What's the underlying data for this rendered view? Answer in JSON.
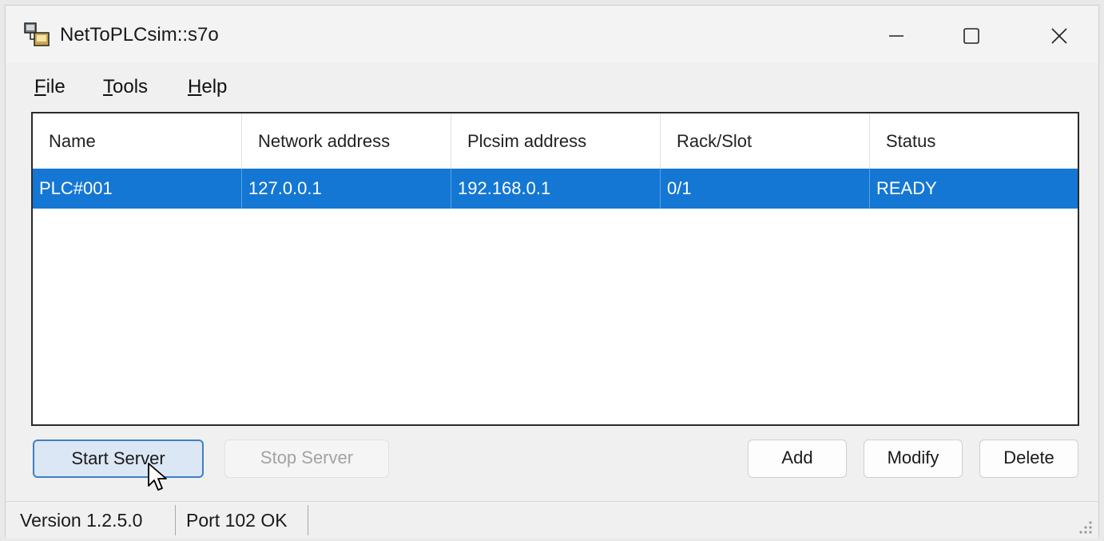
{
  "window": {
    "title": "NetToPLCsim::s7o",
    "controls": {
      "minimize_icon": "minimize-icon",
      "maximize_icon": "maximize-icon",
      "close_icon": "close-icon"
    }
  },
  "menu": {
    "file": {
      "accel": "F",
      "rest": "ile"
    },
    "tools": {
      "accel": "T",
      "rest": "ools"
    },
    "help": {
      "accel": "H",
      "rest": "elp"
    }
  },
  "table": {
    "columns": [
      "Name",
      "Network address",
      "Plcsim address",
      "Rack/Slot",
      "Status"
    ],
    "rows": [
      {
        "name": "PLC#001",
        "network_address": "127.0.0.1",
        "plcsim_address": "192.168.0.1",
        "rack_slot": "0/1",
        "status": "READY",
        "selected": true
      }
    ]
  },
  "buttons": {
    "start_server": "Start Server",
    "stop_server": "Stop Server",
    "add": "Add",
    "modify": "Modify",
    "delete": "Delete"
  },
  "statusbar": {
    "version": "Version 1.2.5.0",
    "port": "Port 102 OK"
  },
  "colors": {
    "selection": "#1477d4",
    "primary_button_border": "#3f7fc5",
    "window_bg": "#f0f0f0"
  }
}
